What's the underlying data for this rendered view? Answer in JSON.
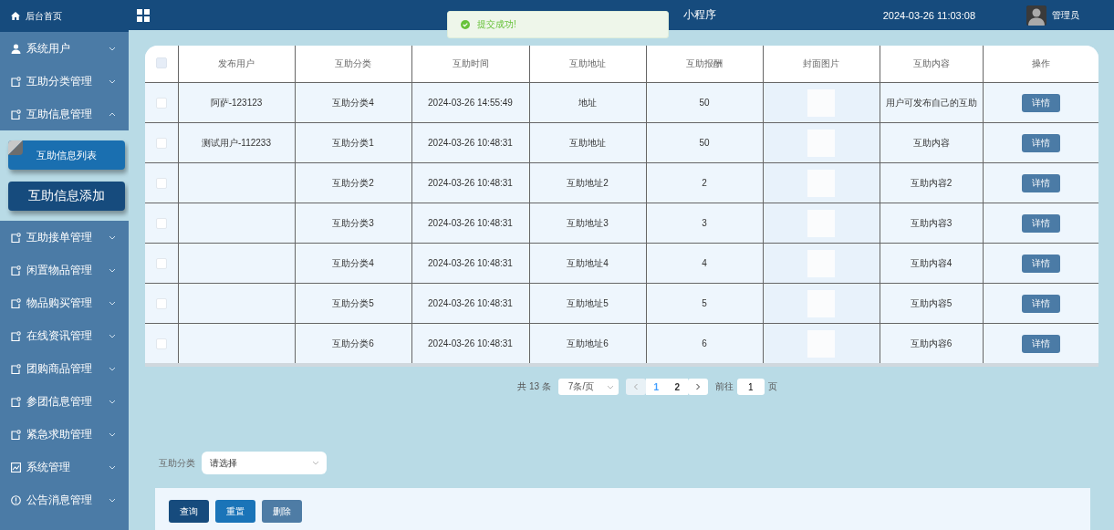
{
  "sidebar": {
    "home": {
      "label": "后台首页"
    },
    "items": [
      {
        "label": "系统用户",
        "kind": "user",
        "expanded": false
      },
      {
        "label": "互助分类管理",
        "kind": "doc",
        "expanded": false
      },
      {
        "label": "互助信息管理",
        "kind": "doc",
        "expanded": true,
        "children": [
          {
            "label": "互助信息列表",
            "selected": true
          },
          {
            "label": "互助信息添加",
            "selected": false
          }
        ]
      },
      {
        "label": "互助接单管理",
        "kind": "doc",
        "expanded": false
      },
      {
        "label": "闲置物品管理",
        "kind": "doc",
        "expanded": false
      },
      {
        "label": "物品购买管理",
        "kind": "doc",
        "expanded": false
      },
      {
        "label": "在线资讯管理",
        "kind": "doc",
        "expanded": false
      },
      {
        "label": "团购商品管理",
        "kind": "doc",
        "expanded": false
      },
      {
        "label": "参团信息管理",
        "kind": "doc",
        "expanded": false
      },
      {
        "label": "紧急求助管理",
        "kind": "doc",
        "expanded": false
      },
      {
        "label": "系统管理",
        "kind": "chart",
        "expanded": false
      },
      {
        "label": "公告消息管理",
        "kind": "info",
        "expanded": false
      }
    ]
  },
  "header": {
    "title": "小程序",
    "datetime": "2024-03-26 11:03:08",
    "user": "管理员"
  },
  "toast": {
    "text": "提交成功!",
    "kind": "success"
  },
  "table": {
    "select_all_checked": false,
    "columns": [
      "发布用户",
      "互助分类",
      "互助时间",
      "互助地址",
      "互助报酬",
      "封面图片",
      "互助内容",
      "操作"
    ],
    "rows": [
      {
        "checked": false,
        "user": "阿萨-123123",
        "category": "互助分类4",
        "time": "2024-03-26 14:55:49",
        "address": "地址",
        "reward": "50",
        "content": "用户可发布自己的互助",
        "action": "详情"
      },
      {
        "checked": false,
        "user": "测试用户-112233",
        "category": "互助分类1",
        "time": "2024-03-26 10:48:31",
        "address": "互助地址",
        "reward": "50",
        "content": "互助内容",
        "action": "详情"
      },
      {
        "checked": false,
        "category": "互助分类2",
        "time": "2024-03-26 10:48:31",
        "address": "互助地址2",
        "reward": "2",
        "content": "互助内容2",
        "action": "详情"
      },
      {
        "checked": false,
        "category": "互助分类3",
        "time": "2024-03-26 10:48:31",
        "address": "互助地址3",
        "reward": "3",
        "content": "互助内容3",
        "action": "详情"
      },
      {
        "checked": false,
        "category": "互助分类4",
        "time": "2024-03-26 10:48:31",
        "address": "互助地址4",
        "reward": "4",
        "content": "互助内容4",
        "action": "详情"
      },
      {
        "checked": false,
        "category": "互助分类5",
        "time": "2024-03-26 10:48:31",
        "address": "互助地址5",
        "reward": "5",
        "content": "互助内容5",
        "action": "详情"
      },
      {
        "checked": false,
        "category": "互助分类6",
        "time": "2024-03-26 10:48:31",
        "address": "互助地址6",
        "reward": "6",
        "content": "互助内容6",
        "action": "详情"
      }
    ]
  },
  "pagination": {
    "total": "共 13 条",
    "page_size": "7条/页",
    "pages": [
      {
        "label": "1",
        "selected": true
      },
      {
        "label": "2",
        "selected": false
      }
    ],
    "goto_label": "前往",
    "goto_value": "1",
    "goto_suffix": "页"
  },
  "filter": {
    "label": "互助分类",
    "placeholder": "请选择"
  },
  "buttons": [
    {
      "label": "查询",
      "kind": "primary"
    },
    {
      "label": "重置",
      "kind": "secondary"
    },
    {
      "label": "删除",
      "kind": "danger"
    }
  ]
}
